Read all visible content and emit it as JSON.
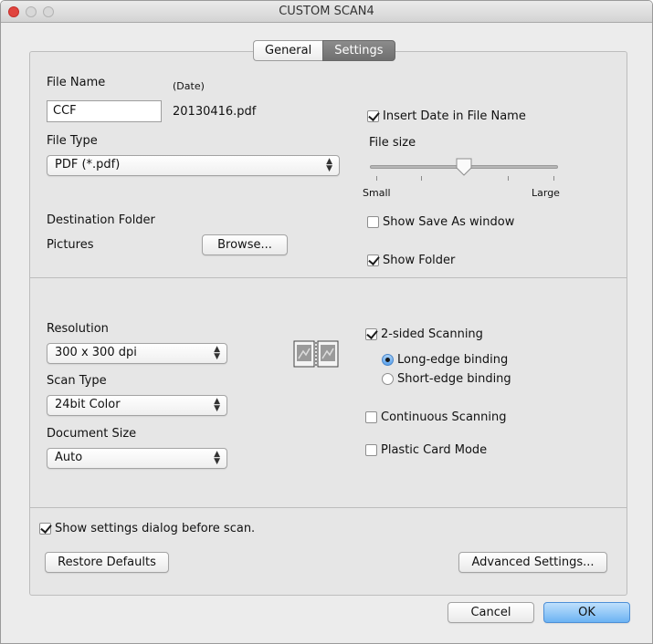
{
  "window": {
    "title": "CUSTOM SCAN4"
  },
  "tabs": [
    {
      "label": "General",
      "active": false
    },
    {
      "label": "Settings",
      "active": true
    }
  ],
  "file": {
    "name_label": "File Name",
    "date_label": "(Date)",
    "name_value": "CCF",
    "date_value": "20130416.pdf",
    "type_label": "File Type",
    "type_value": "PDF (*.pdf)",
    "dest_label": "Destination Folder",
    "dest_value": "Pictures",
    "browse_button": "Browse..."
  },
  "options": {
    "insert_date": {
      "label": "Insert Date in File Name",
      "checked": true
    },
    "file_size_label": "File size",
    "file_size_min": "Small",
    "file_size_max": "Large",
    "file_size_level": 0.5,
    "show_save_as": {
      "label": "Show Save As window",
      "checked": false
    },
    "show_folder": {
      "label": "Show Folder",
      "checked": true
    }
  },
  "scan": {
    "resolution_label": "Resolution",
    "resolution_value": "300 x 300 dpi",
    "scan_type_label": "Scan Type",
    "scan_type_value": "24bit Color",
    "doc_size_label": "Document Size",
    "doc_size_value": "Auto",
    "two_sided": {
      "label": "2-sided Scanning",
      "checked": true
    },
    "long_edge": {
      "label": "Long-edge binding",
      "selected": true
    },
    "short_edge": {
      "label": "Short-edge binding",
      "selected": false
    },
    "continuous": {
      "label": "Continuous Scanning",
      "checked": false
    },
    "plastic_card": {
      "label": "Plastic Card Mode",
      "checked": false
    }
  },
  "footer": {
    "show_settings": {
      "label": "Show settings dialog before scan.",
      "checked": true
    },
    "restore_button": "Restore Defaults",
    "advanced_button": "Advanced Settings...",
    "cancel_button": "Cancel",
    "ok_button": "OK"
  },
  "colors": {
    "accent": "#6cb3f3",
    "close_button": "#e0443e"
  }
}
